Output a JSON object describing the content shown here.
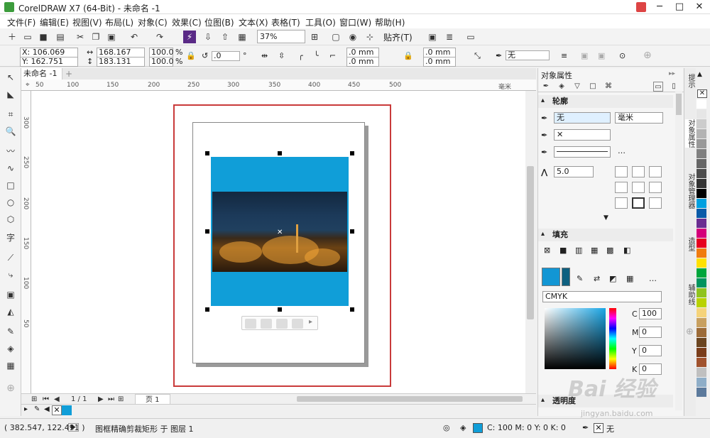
{
  "window": {
    "title": "CorelDRAW X7 (64-Bit) - 未命名 -1",
    "controls": [
      "─",
      "□",
      "✕"
    ]
  },
  "menu": [
    "文件(F)",
    "编辑(E)",
    "视图(V)",
    "布局(L)",
    "对象(C)",
    "效果(C)",
    "位图(B)",
    "文本(X)",
    "表格(T)",
    "工具(O)",
    "窗口(W)",
    "帮助(H)"
  ],
  "toolbar": {
    "zoom": "37%",
    "snap_label": "贴齐(T)"
  },
  "propbar": {
    "x": "X: 106.069 mm",
    "y": "Y: 162.751 mm",
    "w": "168.167 mm",
    "h": "183.131 mm",
    "sx": "100.0",
    "sy": "100.0",
    "pct1": "%",
    "pct2": "%",
    "rotation": ".0",
    "deg": "°",
    "c1": ".0 mm",
    "c2": ".0 mm",
    "c3": ".0 mm",
    "c4": ".0 mm",
    "outline": "无"
  },
  "document": {
    "tab": "未命名 -1",
    "add_tab": "+"
  },
  "rulers": {
    "h": [
      "50",
      "100",
      "150",
      "200",
      "250",
      "300",
      "350",
      "400",
      "450",
      "500"
    ],
    "v": [
      "300",
      "250",
      "200",
      "150",
      "100",
      "50"
    ],
    "unit": "毫米"
  },
  "pagenav": {
    "counter": "1 / 1",
    "page_tab": "页 1"
  },
  "status": {
    "coords": "( 382.547, 122.491 )",
    "message": "图框精确剪裁矩形 于 图层 1",
    "fill_info": "C: 100 M: 0 Y: 0 K: 0",
    "outline_info": "无"
  },
  "docker": {
    "title": "对象属性",
    "outline_section": "轮廓",
    "outline_width": "无",
    "outline_unit": "毫米",
    "miter": "5.0",
    "fill_section": "填充",
    "color_model": "CMYK",
    "cmyk": {
      "c": "100",
      "m": "0",
      "y": "0",
      "k": "0"
    },
    "cmyk_labels": {
      "c": "C",
      "m": "M",
      "y": "Y",
      "k": "K"
    },
    "transparency_section": "透明度"
  },
  "vtabs": [
    "提示",
    "对象属性",
    "对象管理器",
    "造型",
    "辅助线"
  ],
  "watermark": {
    "text": "Bai 经验",
    "url": "jingyan.baidu.com"
  },
  "colors": {
    "accent_blue": "#109ed8",
    "frame_red": "#c93a3a",
    "palette": [
      "#ffffff",
      "#e6e6e6",
      "#cccccc",
      "#b3b3b3",
      "#999999",
      "#808080",
      "#666666",
      "#4d4d4d",
      "#333333",
      "#000000",
      "#00a0e0",
      "#0a5ba8",
      "#6a2d91",
      "#d4007a",
      "#e6001f",
      "#f07b0f",
      "#ffe100",
      "#00a63c",
      "#00945e",
      "#8fc31f",
      "#b8d200",
      "#f5d37a",
      "#c8a060",
      "#9c6b38",
      "#6b4520",
      "#7a3d1a",
      "#a0522d",
      "#c0c0c0",
      "#8faec8",
      "#5c7a9c"
    ]
  }
}
